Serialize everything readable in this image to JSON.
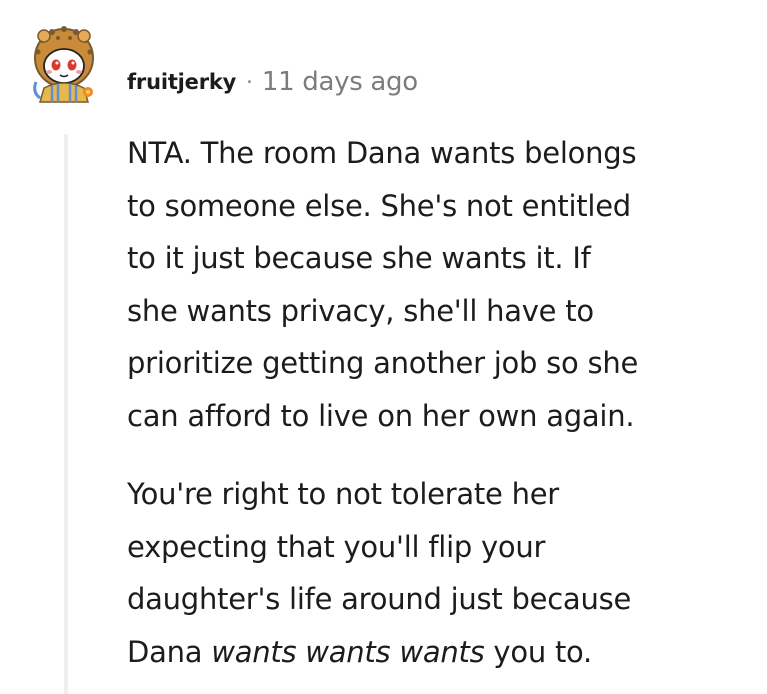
{
  "comment": {
    "username": "fruitjerky",
    "separator": "·",
    "timestamp": "11 days ago",
    "avatar_icon": "snoo-avatar-lion-hood-icon",
    "paragraphs": [
      {
        "lines": [
          "NTA. The room Dana wants belongs",
          "to someone else. She's not entitled",
          "to it just because she wants it. If",
          "she wants privacy, she'll have to",
          "prioritize getting another job so she",
          "can afford to live on her own again."
        ]
      },
      {
        "lines": [
          "You're right to not tolerate her",
          "expecting that you'll flip your",
          "daughter's life around just because"
        ],
        "last_line": {
          "before": "Dana ",
          "emphasis": "wants wants wants",
          "after": " you to."
        }
      }
    ]
  },
  "colors": {
    "text": "#1c1c1c",
    "meta": "#7c7c7c",
    "thread_line": "#edeff1",
    "avatar_fur": "#c98a3a",
    "avatar_ring": "#7a5a2c"
  }
}
